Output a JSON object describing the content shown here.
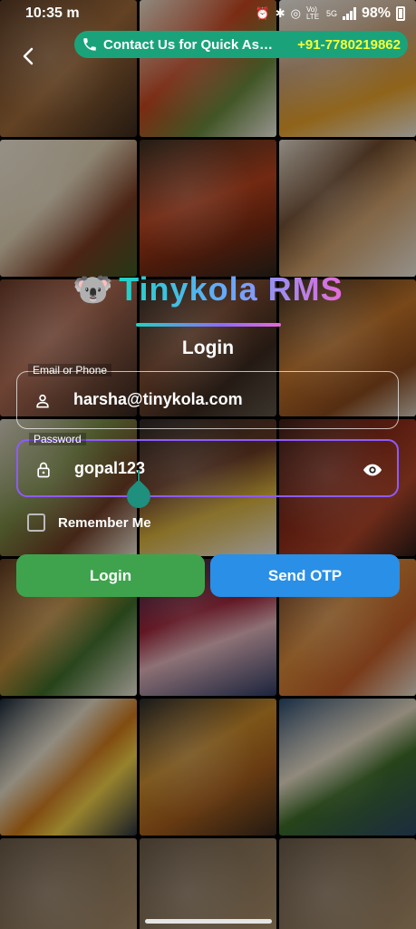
{
  "status_bar": {
    "time": "10:35 m",
    "lte": "Vo) LTE",
    "network": "5G",
    "battery": "98%"
  },
  "contact": {
    "message": "Contact Us for Quick Assistance",
    "phone": "+91-7780219862"
  },
  "brand": {
    "name": "Tinykola RMS",
    "emoji": "🐨"
  },
  "form": {
    "title": "Login",
    "email_label": "Email or Phone",
    "email_value": "harsha@tinykola.com",
    "password_label": "Password",
    "password_value": "gopal123",
    "remember_label": "Remember Me",
    "login_button": "Login",
    "otp_button": "Send OTP"
  },
  "colors": {
    "contact_bg": "#1aa37a",
    "phone_number": "#f4ff3a",
    "login_button": "#3fa34d",
    "otp_button": "#2a8fe6",
    "password_border": "#8e5bff"
  }
}
